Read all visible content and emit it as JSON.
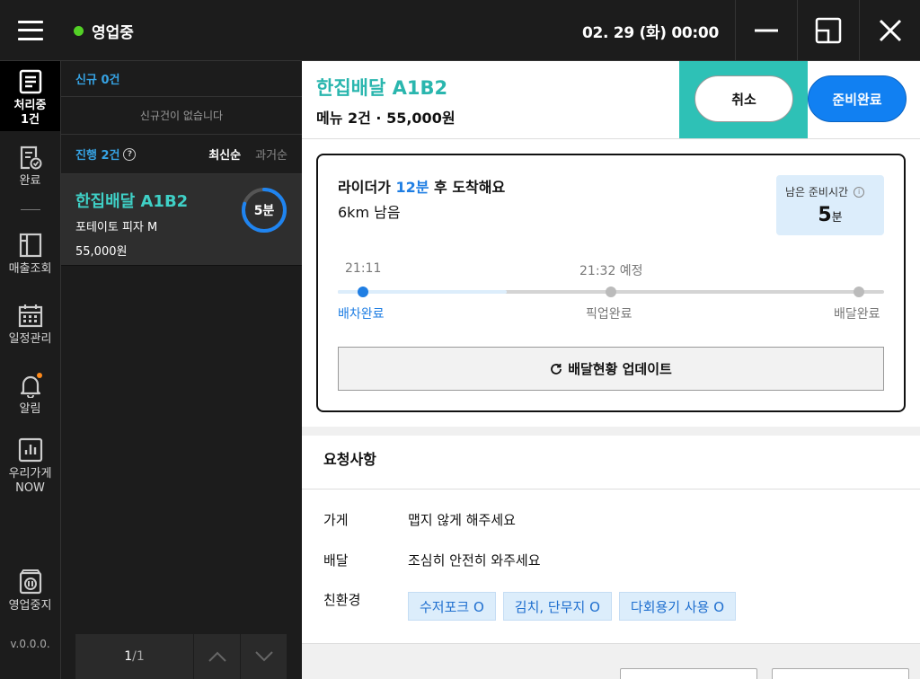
{
  "topbar": {
    "status": "영업중",
    "datetime": "02. 29 (화) 00:00"
  },
  "sidebar": {
    "items": [
      {
        "label": "처리중",
        "sub": "1건",
        "icon": "clipboard-list-icon"
      },
      {
        "label": "완료",
        "icon": "document-check-icon"
      },
      {
        "label": "매출조회",
        "icon": "ledger-icon"
      },
      {
        "label": "일정관리",
        "icon": "calendar-icon"
      },
      {
        "label": "알림",
        "icon": "bell-icon"
      },
      {
        "label": "우리가게",
        "sub": "NOW",
        "icon": "bar-chart-icon"
      },
      {
        "label": "영업중지",
        "icon": "pause-store-icon"
      }
    ],
    "version": "v.0.0.0."
  },
  "list": {
    "new_header": "신규 0건",
    "empty_text": "신규건이 없습니다",
    "progress_label": "진행 2건",
    "sort_latest": "최신순",
    "sort_oldest": "과거순",
    "orders": [
      {
        "title": "한집배달 A1B2",
        "menu": "포테이토 피자 M",
        "price": "55,000원",
        "timer": "5분",
        "timer_progress": 0.8
      }
    ],
    "pager": {
      "current": "1",
      "total": "/1"
    }
  },
  "detail": {
    "title": "한집배달 A1B2",
    "subtitle": "메뉴 2건 · 55,000원",
    "cancel_label": "취소",
    "ready_label": "준비완료",
    "rider": {
      "line1_pre": "라이더가 ",
      "line1_highlight": "12분",
      "line1_post": " 후 도착해요",
      "distance": "6km 남음",
      "remain_label": "남은 준비시간",
      "remain_value": "5",
      "remain_unit": "분"
    },
    "timeline": {
      "time_dispatch": "21:11",
      "time_pickup": "21:32 예정",
      "steps": [
        "배차완료",
        "픽업완료",
        "배달완료"
      ]
    },
    "update_label": "배달현황 업데이트",
    "requests": {
      "title": "요청사항",
      "store_key": "가게",
      "store_value": "맵지 않게 해주세요",
      "delivery_key": "배달",
      "delivery_value": "조심히 안전히 와주세요",
      "eco_key": "친환경",
      "eco_tags": [
        "수저포크 O",
        "김치, 단무지 O",
        "다회용기 사용 O"
      ]
    }
  },
  "colors": {
    "accent_teal": "#2ec1b6",
    "accent_blue": "#1180f2",
    "status_green": "#53d026"
  }
}
